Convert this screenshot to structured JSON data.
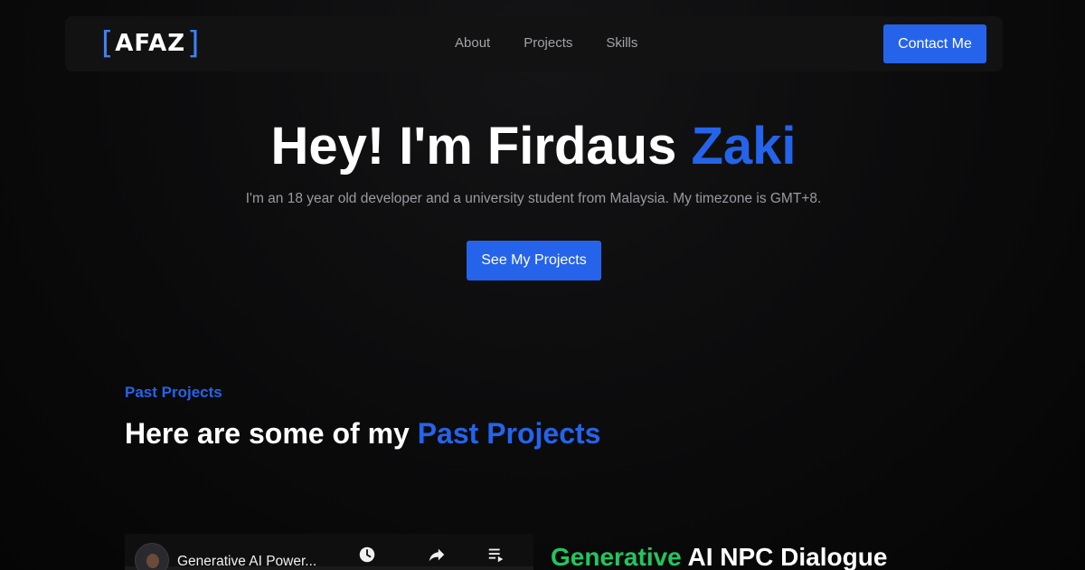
{
  "nav": {
    "logo": {
      "left_bracket": "[",
      "text": "AFAZ",
      "right_bracket": "]"
    },
    "links": [
      {
        "label": "About"
      },
      {
        "label": "Projects"
      },
      {
        "label": "Skills"
      }
    ],
    "contact_label": "Contact Me"
  },
  "hero": {
    "title_prefix": "Hey! I'm Firdaus ",
    "title_accent": "Zaki",
    "subtitle": "I'm an 18 year old developer and a university student from Malaysia. My timezone is GMT+8.",
    "cta_label": "See My Projects"
  },
  "section": {
    "eyebrow": "Past Projects",
    "title_prefix": "Here are some of my ",
    "title_accent": "Past Projects"
  },
  "video": {
    "title": "Generative AI Power...",
    "icons": [
      "clock-icon",
      "share-icon",
      "playlist-icon"
    ]
  },
  "project": {
    "title_green": "Generative",
    "title_rest": " AI NPC Dialogue"
  },
  "colors": {
    "accent": "#2563eb",
    "green": "#22c55e",
    "background": "#0b0b0c"
  }
}
